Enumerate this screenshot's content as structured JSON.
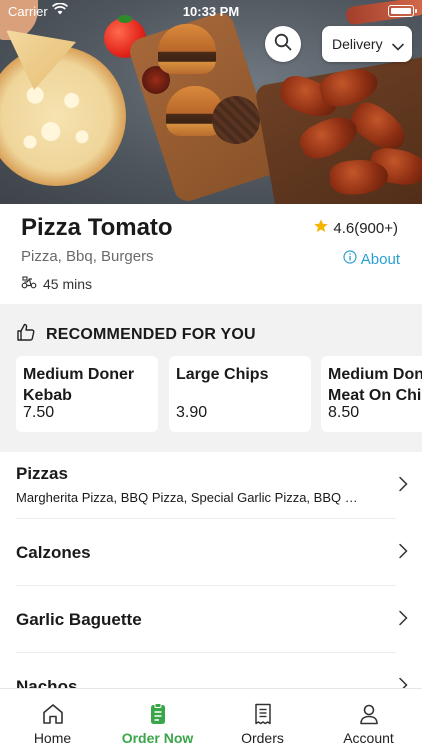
{
  "status_bar": {
    "carrier": "Carrier",
    "time": "10:33 PM"
  },
  "header": {
    "search_icon": "search-icon",
    "delivery_mode": "Delivery"
  },
  "restaurant": {
    "name": "Pizza Tomato",
    "rating": "4.6(900+)",
    "cuisines": "Pizza, Bbq, Burgers",
    "about_label": "About",
    "delivery_time": "45 mins"
  },
  "recommended": {
    "title": "RECOMMENDED FOR YOU",
    "items": [
      {
        "name": "Medium Doner Kebab",
        "price": "7.50"
      },
      {
        "name": "Large Chips",
        "price": "3.90"
      },
      {
        "name": "Medium Doner Meat On Chips",
        "price": "8.50"
      }
    ]
  },
  "menu": {
    "categories": [
      {
        "title": "Pizzas",
        "items": "Margherita Pizza, BBQ Pizza, Special Garlic Pizza, BBQ Chicken Pizza"
      },
      {
        "title": "Calzones"
      },
      {
        "title": "Garlic Baguette"
      },
      {
        "title": "Nachos"
      }
    ]
  },
  "tabbar": {
    "tabs": [
      {
        "label": "Home",
        "icon": "home-icon"
      },
      {
        "label": "Order Now",
        "icon": "order-icon"
      },
      {
        "label": "Orders",
        "icon": "receipt-icon"
      },
      {
        "label": "Account",
        "icon": "account-icon"
      }
    ]
  },
  "colors": {
    "accent": "#3aa64a",
    "link": "#2a9fd0",
    "star": "#f5b400"
  }
}
